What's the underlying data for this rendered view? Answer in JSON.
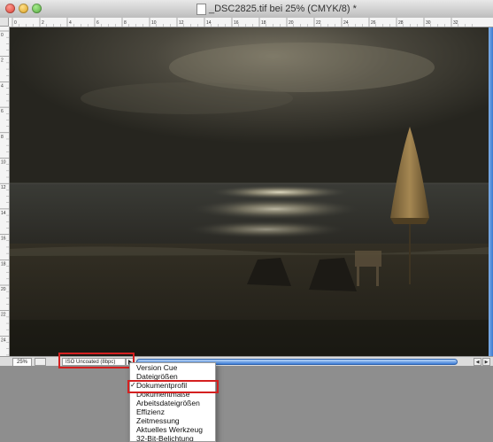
{
  "window": {
    "title": "_DSC2825.tif bei 25% (CMYK/8) *"
  },
  "ruler": {
    "h_ticks": [
      "0",
      "2",
      "4",
      "6",
      "8",
      "10",
      "12",
      "14",
      "16",
      "18",
      "20",
      "22",
      "24",
      "26",
      "28",
      "30",
      "32"
    ],
    "v_ticks": [
      "0",
      "2",
      "4",
      "6",
      "8",
      "10",
      "12",
      "14",
      "16",
      "18",
      "20",
      "22",
      "24"
    ]
  },
  "canvas": {
    "image_description": "night beach photo"
  },
  "statusbar": {
    "zoom": "25%",
    "profile": "ISO Uncoated (8bpc)"
  },
  "menu": {
    "items": [
      {
        "label": "Version Cue",
        "checked": false
      },
      {
        "label": "Dateigrößen",
        "checked": false
      },
      {
        "label": "Dokumentprofil",
        "checked": true
      },
      {
        "label": "Dokumentmaße",
        "checked": false
      },
      {
        "label": "Arbeitsdateigrößen",
        "checked": false
      },
      {
        "label": "Effizienz",
        "checked": false
      },
      {
        "label": "Zeitmessung",
        "checked": false
      },
      {
        "label": "Aktuelles Werkzeug",
        "checked": false
      },
      {
        "label": "32-Bit-Belichtung",
        "checked": false
      }
    ],
    "check_mark": "✓"
  },
  "colors": {
    "highlight": "#d42020",
    "scroll": "#3c7cd6"
  }
}
